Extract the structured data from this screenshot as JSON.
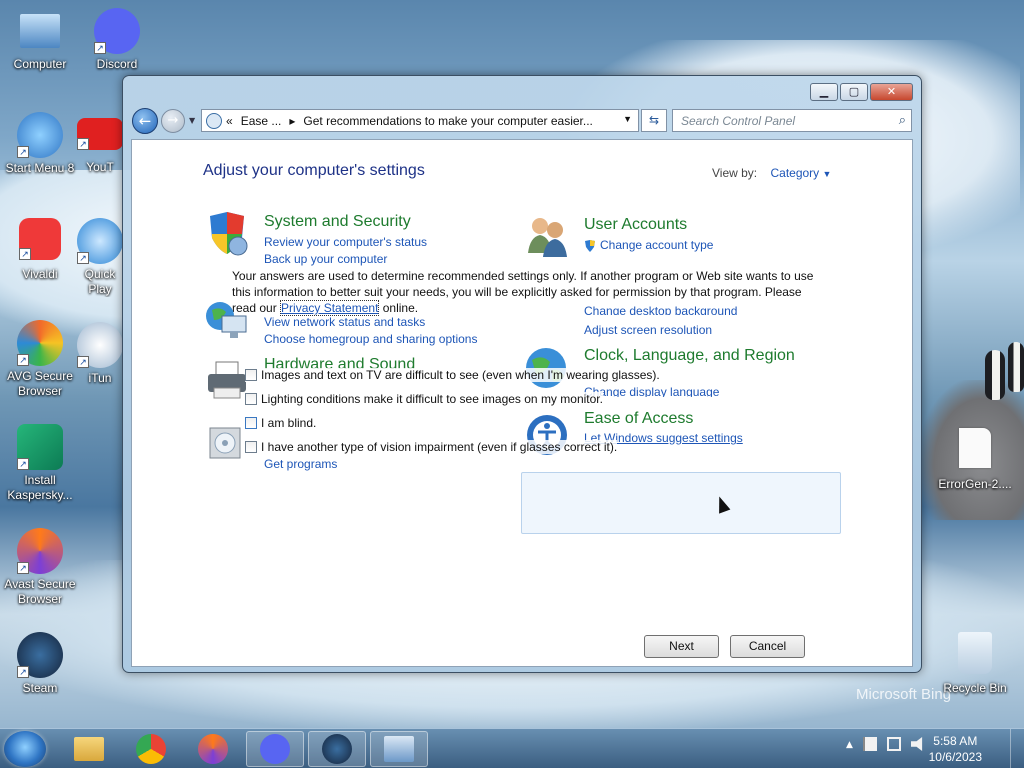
{
  "desktop": {
    "icons": [
      {
        "label": "Computer"
      },
      {
        "label": "Discord"
      },
      {
        "label": "Start Menu 8"
      },
      {
        "label": "YouT"
      },
      {
        "label": "Vivaldi"
      },
      {
        "label": "Quick Play"
      },
      {
        "label": "AVG Secure Browser"
      },
      {
        "label": "iTun"
      },
      {
        "label": "Install Kaspersky..."
      },
      {
        "label": "Avast Secure Browser"
      },
      {
        "label": "Steam"
      },
      {
        "label": "ErrorGen-2...."
      },
      {
        "label": "Recycle Bin"
      }
    ],
    "watermark": "Microsoft Bing"
  },
  "window": {
    "address": {
      "crumb1": "Ease ...",
      "crumb2": "Get recommendations to make your computer easier..."
    },
    "search_placeholder": "Search Control Panel",
    "title": "Adjust your computer's settings",
    "view_by_label": "View by:",
    "view_by_value": "Category",
    "categories": [
      {
        "title": "System and Security",
        "links": [
          "Review your computer's status",
          "Back up your computer"
        ]
      },
      {
        "title": "User Accounts",
        "links": [
          "Change account type"
        ]
      },
      {
        "title": "",
        "links": [
          "View network status and tasks",
          "Choose homegroup and sharing options"
        ]
      },
      {
        "title": "",
        "links": [
          "Change desktop background",
          "Adjust screen resolution"
        ]
      },
      {
        "title": "Hardware and Sound",
        "links": []
      },
      {
        "title": "Clock, Language, and Region",
        "links": [
          "Change display language"
        ]
      },
      {
        "title": "Ease of Access",
        "links": [
          "Let Windows suggest settings"
        ]
      },
      {
        "title": "",
        "links": [
          "Get programs"
        ]
      }
    ],
    "prompt": {
      "text_before": "Your answers are used to determine recommended settings only. If another program or Web site wants to use this information to better suit your needs, you will be explicitly asked for permission by that program. Please read our ",
      "link": "Privacy Statement",
      "text_after": " online."
    },
    "checkboxes": [
      {
        "label": "Images and text on TV are difficult to see (even when I'm wearing glasses).",
        "checked": false
      },
      {
        "label": "Lighting conditions make it difficult to see images on my monitor.",
        "checked": false
      },
      {
        "label": "I am blind.",
        "checked": false
      },
      {
        "label": "I have another type of vision impairment (even if glasses correct it).",
        "checked": false
      }
    ],
    "buttons": {
      "next": "Next",
      "cancel": "Cancel"
    }
  },
  "taskbar": {
    "clock_time": "5:58 AM",
    "clock_date": "10/6/2023",
    "tray_arrow": "▲"
  }
}
